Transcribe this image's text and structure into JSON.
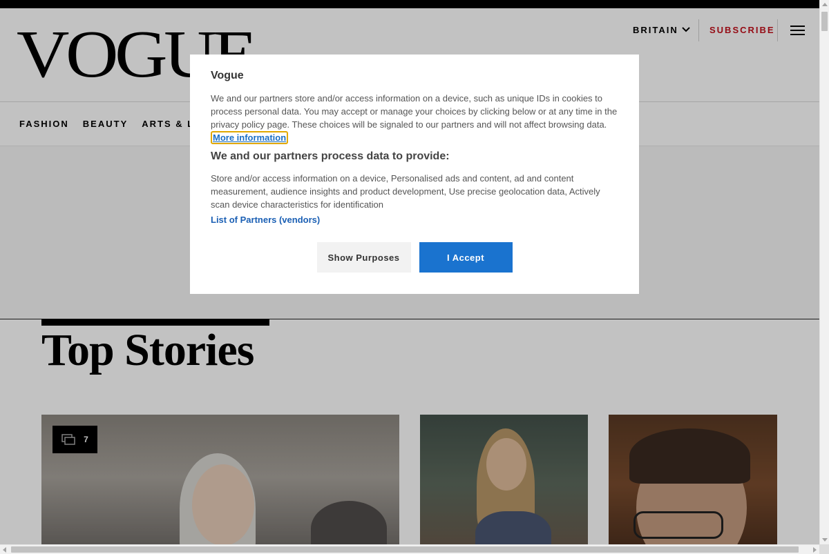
{
  "header": {
    "logo": "VOGUE",
    "region": "BRITAIN",
    "subscribe": "SUBSCRIBE"
  },
  "nav": {
    "items": [
      "FASHION",
      "BEAUTY",
      "ARTS & LIFE"
    ]
  },
  "section": {
    "title": "Top Stories"
  },
  "cards": [
    {
      "gallery_count": "7"
    }
  ],
  "consent": {
    "title": "Vogue",
    "description": "We and our partners store and/or access information on a device, such as unique IDs in cookies to process personal data. You may accept or manage your choices by clicking below or at any time in the privacy policy page. These choices will be signaled to our partners and will not affect browsing data.",
    "more_info": "More information",
    "subtitle": "We and our partners process data to provide:",
    "purposes": "Store and/or access information on a device, Personalised ads and content, ad and content measurement, audience insights and product development, Use precise geolocation data, Actively scan device characteristics for identification",
    "partners_link": "List of Partners (vendors)",
    "show_purposes": "Show Purposes",
    "accept": "I Accept"
  },
  "colors": {
    "subscribe": "#c4101c",
    "accept_button": "#1a73cf",
    "link": "#1a5fb4"
  }
}
